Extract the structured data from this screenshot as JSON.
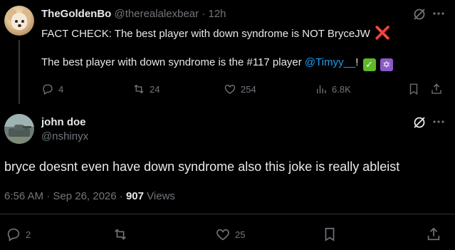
{
  "tweet1": {
    "author_name": "TheGoldenBo",
    "author_handle": "@therealalexbear",
    "separator": "·",
    "time": "12h",
    "line1": "FACT CHECK: The best player with down syndrome is NOT BryceJW",
    "line1_emoji": "❌",
    "line2_prefix": "The best player with down syndrome is the #117 player",
    "mention": "@Timyy__",
    "line2_suffix": "!",
    "emoji_check": "✓",
    "emoji_star": "✡",
    "replies": "4",
    "reposts": "24",
    "likes": "254",
    "views": "6.8K"
  },
  "tweet2": {
    "author_name": "john doe",
    "author_handle": "@nshinyx",
    "text": "bryce doesnt even have down syndrome also this joke is really ableist",
    "time": "6:56 AM · Sep 26, 2026 ·",
    "views_count": "907",
    "views_label": "Views",
    "replies": "2",
    "reposts": "",
    "likes": "25"
  },
  "icons": [
    "grok-icon",
    "more-icon",
    "reply-icon",
    "repost-icon",
    "like-icon",
    "views-icon",
    "bookmark-icon",
    "share-icon"
  ],
  "colors": {
    "background": "#000000",
    "text": "#e7e9ea",
    "muted": "#71767b",
    "link": "#1d9bf0"
  }
}
